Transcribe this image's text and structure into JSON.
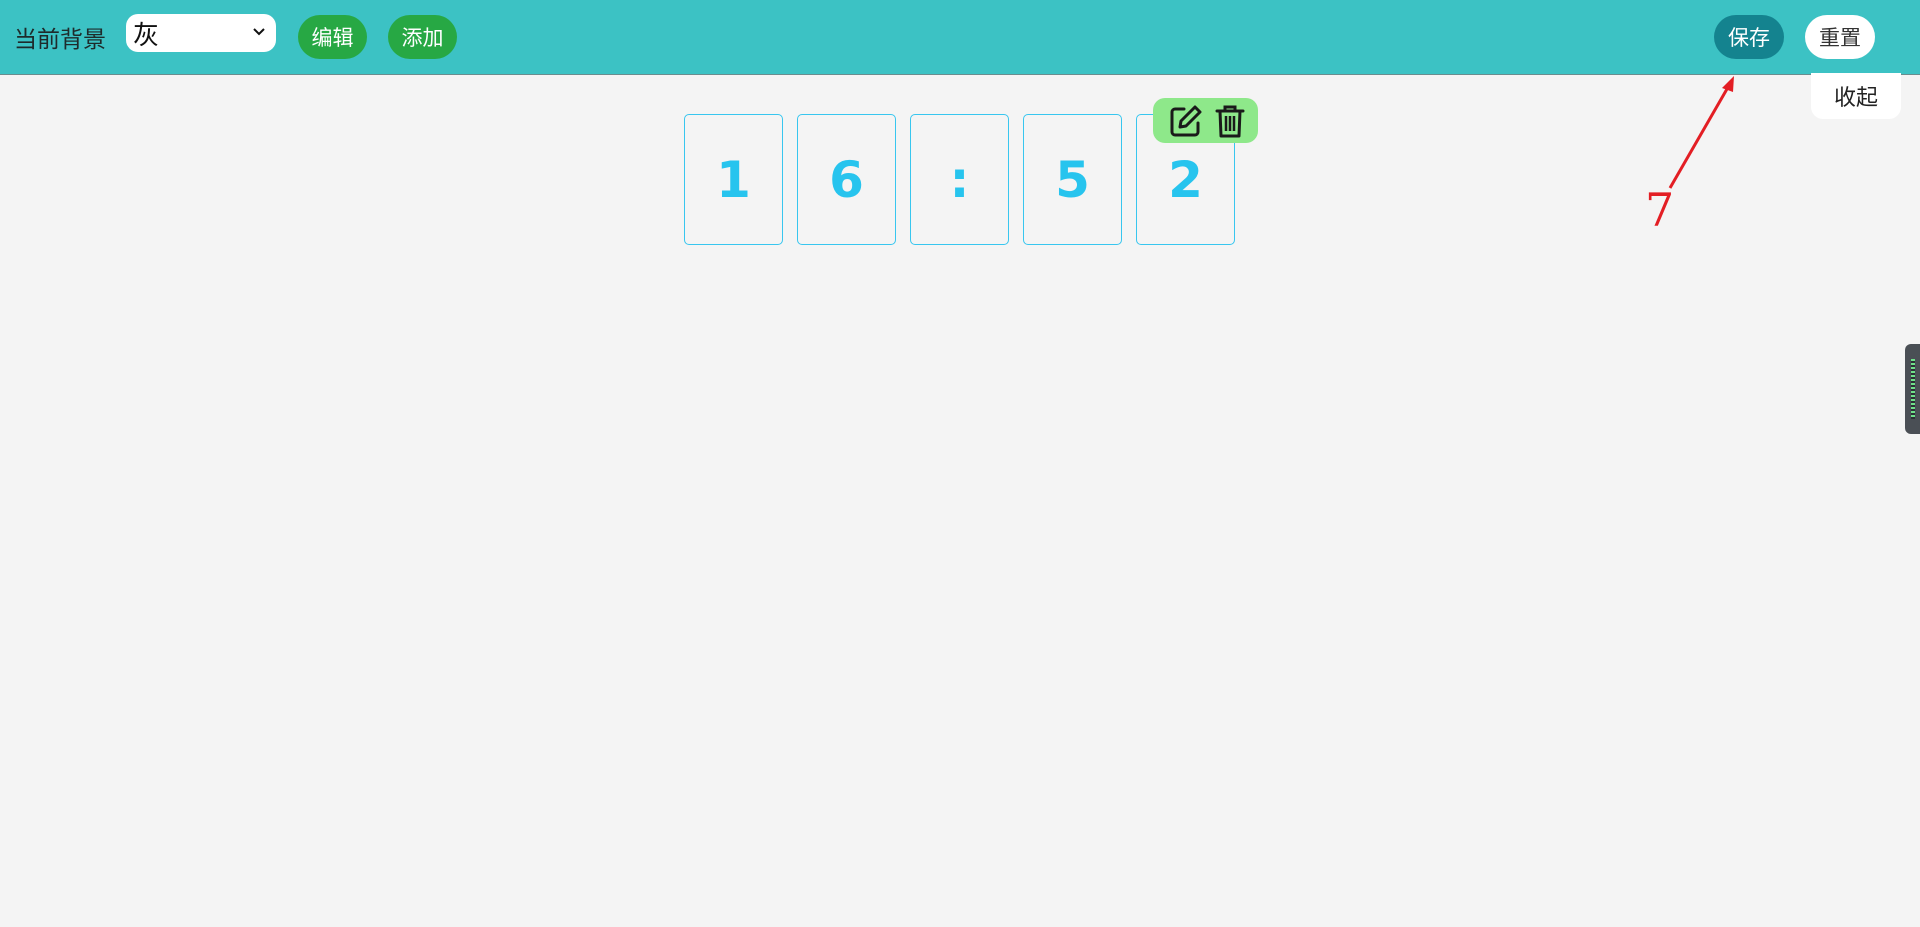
{
  "toolbar": {
    "background_label": "当前背景",
    "background_value": "灰",
    "edit_label": "编辑",
    "add_label": "添加",
    "save_label": "保存",
    "reset_label": "重置"
  },
  "collapse_label": "收起",
  "clock_digits": [
    "1",
    "6",
    ":",
    "5",
    "2"
  ],
  "annotation_number": "7",
  "icons": {
    "dropdown": "chevron-down-icon",
    "edit": "edit-icon",
    "delete": "trash-icon"
  },
  "colors": {
    "topbar": "#3cc2c4",
    "green_button": "#27a844",
    "save_button": "#14838f",
    "digit": "#27c4ee",
    "toolbox": "#8ee88a",
    "annotation": "#e31e24"
  }
}
